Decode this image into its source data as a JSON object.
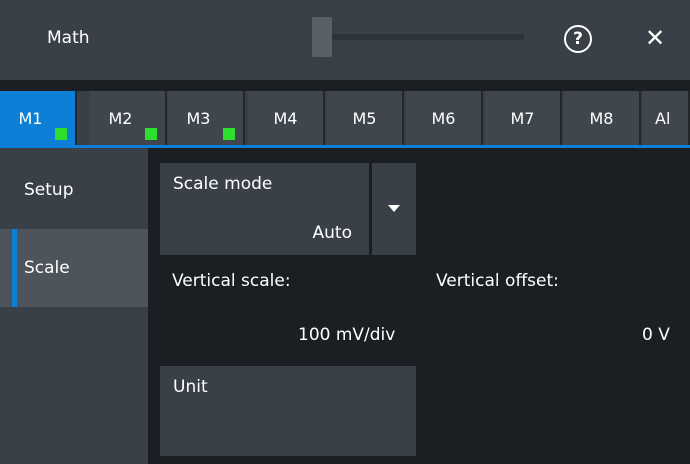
{
  "window": {
    "title": "Math"
  },
  "header_icons": [
    "help-icon",
    "close-icon"
  ],
  "tabs": [
    {
      "label": "M1",
      "active": true,
      "indicator": true
    },
    {
      "label": "M2",
      "active": false,
      "indicator": true
    },
    {
      "label": "M3",
      "active": false,
      "indicator": true
    },
    {
      "label": "M4",
      "active": false,
      "indicator": false
    },
    {
      "label": "M5",
      "active": false,
      "indicator": false
    },
    {
      "label": "M6",
      "active": false,
      "indicator": false
    },
    {
      "label": "M7",
      "active": false,
      "indicator": false
    },
    {
      "label": "M8",
      "active": false,
      "indicator": false
    },
    {
      "label": "Al",
      "active": false,
      "indicator": false
    }
  ],
  "sidebar": {
    "items": [
      {
        "label": "Setup",
        "active": false
      },
      {
        "label": "Scale",
        "active": true
      }
    ]
  },
  "scale_mode": {
    "label": "Scale mode",
    "value": "Auto"
  },
  "vertical_scale": {
    "label": "Vertical scale:",
    "value": "100 mV/div"
  },
  "vertical_offset": {
    "label": "Vertical offset:",
    "value": "0 V"
  },
  "unit": {
    "label": "Unit"
  },
  "colors": {
    "accent": "#0e7fd6",
    "indicator": "#2edf2e",
    "panel": "#3a4047",
    "background": "#1b1f24"
  }
}
